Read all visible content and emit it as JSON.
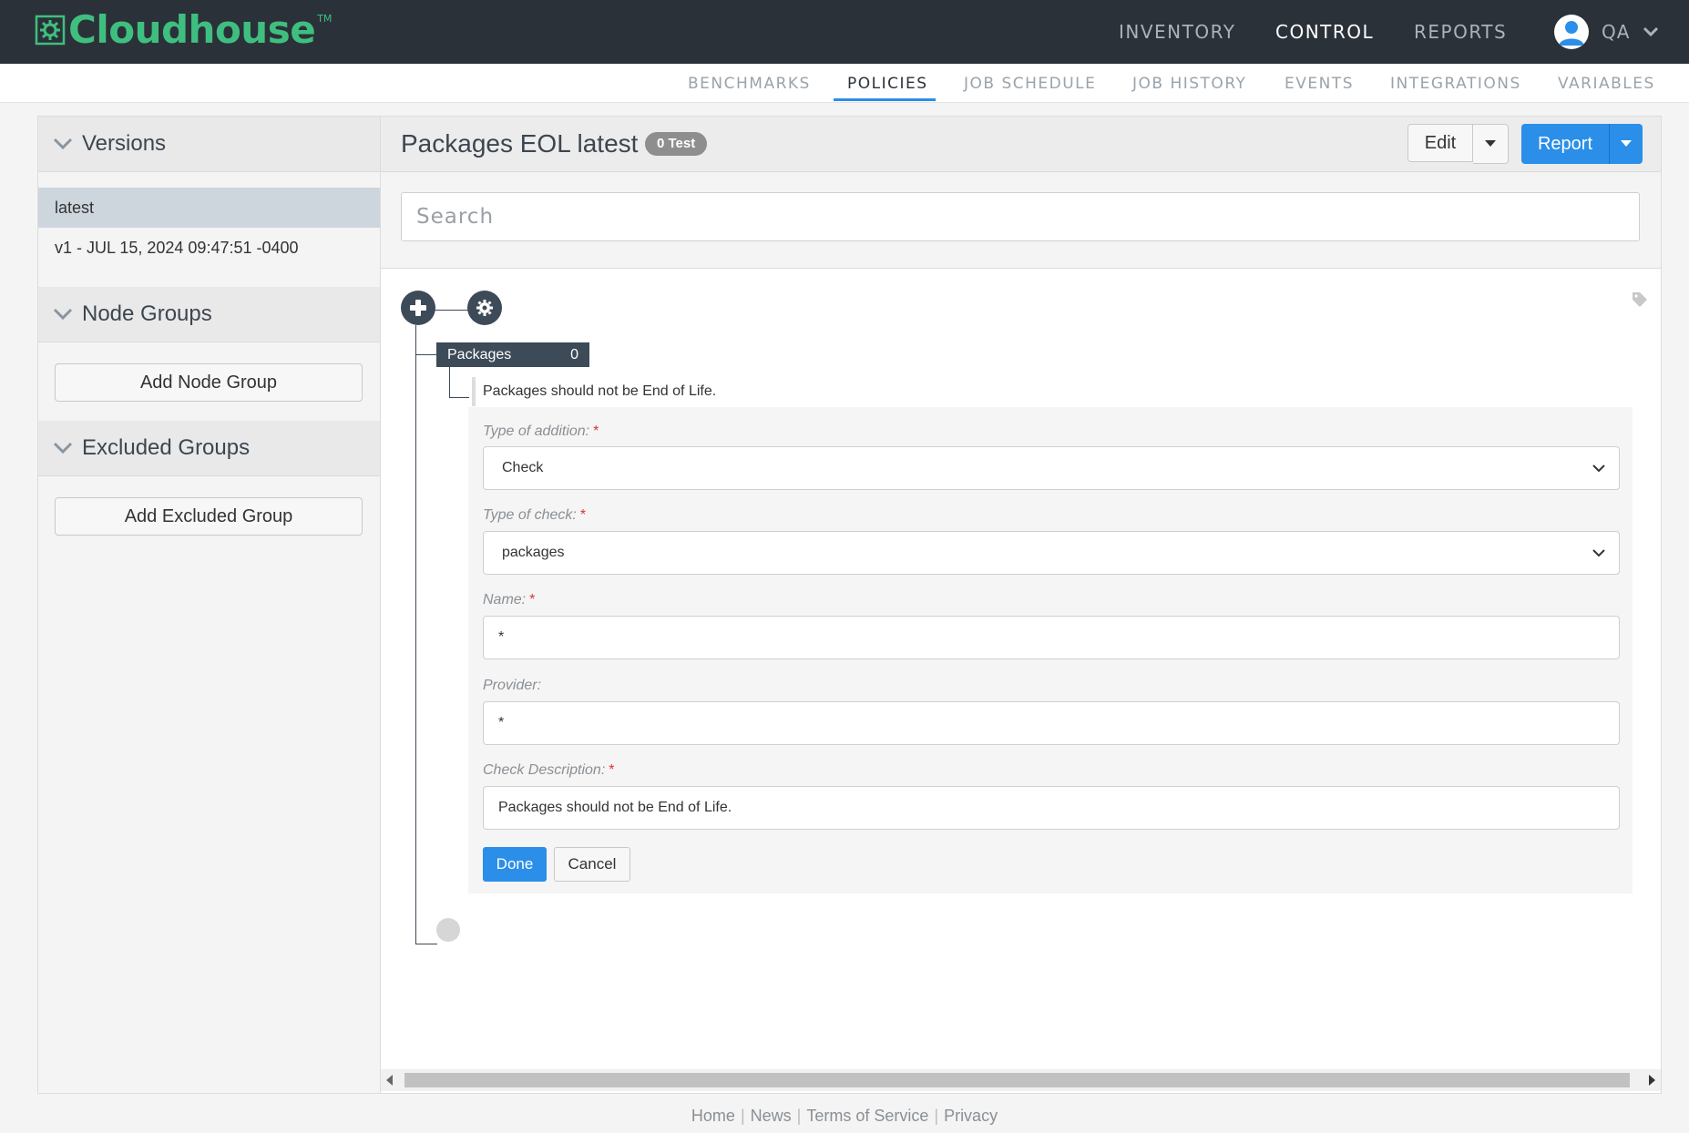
{
  "brand": {
    "name": "Cloudhouse",
    "tm": "TM",
    "accent": "#3fbf7f"
  },
  "topnav": {
    "items": [
      {
        "label": "INVENTORY",
        "active": false
      },
      {
        "label": "CONTROL",
        "active": true
      },
      {
        "label": "REPORTS",
        "active": false
      }
    ],
    "user": {
      "name": "QA",
      "icon": "user-avatar-icon"
    }
  },
  "subnav": {
    "items": [
      {
        "label": "BENCHMARKS"
      },
      {
        "label": "POLICIES",
        "active": true
      },
      {
        "label": "JOB SCHEDULE"
      },
      {
        "label": "JOB HISTORY"
      },
      {
        "label": "EVENTS"
      },
      {
        "label": "INTEGRATIONS"
      },
      {
        "label": "VARIABLES"
      }
    ]
  },
  "sidebar": {
    "versions": {
      "title": "Versions",
      "items": [
        {
          "label": "latest",
          "selected": true
        },
        {
          "label": "v1 - JUL 15, 2024 09:47:51 -0400"
        }
      ]
    },
    "node_groups": {
      "title": "Node Groups",
      "button": "Add Node Group"
    },
    "excluded_groups": {
      "title": "Excluded Groups",
      "button": "Add Excluded Group"
    }
  },
  "main": {
    "title": "Packages EOL latest",
    "badge": "0 Test",
    "edit_label": "Edit",
    "report_label": "Report",
    "search": {
      "placeholder": "Search",
      "value": ""
    },
    "tree": {
      "node": {
        "label": "Packages",
        "count": "0"
      },
      "check_label": "Packages should not be End of Life."
    },
    "form": {
      "type_of_addition": {
        "label": "Type of addition:",
        "value": "Check"
      },
      "type_of_check": {
        "label": "Type of check:",
        "value": "packages"
      },
      "name": {
        "label": "Name:",
        "value": "*"
      },
      "provider": {
        "label": "Provider:",
        "value": "*"
      },
      "check_description": {
        "label": "Check Description:",
        "value": "Packages should not be End of Life."
      },
      "required_mark": "*",
      "done_label": "Done",
      "cancel_label": "Cancel"
    }
  },
  "footer": {
    "links": [
      "Home",
      "News",
      "Terms of Service",
      "Privacy"
    ],
    "separator": "|"
  },
  "colors": {
    "primary": "#2b8ee8",
    "header": "#2b3139",
    "node": "#3d4a58"
  }
}
